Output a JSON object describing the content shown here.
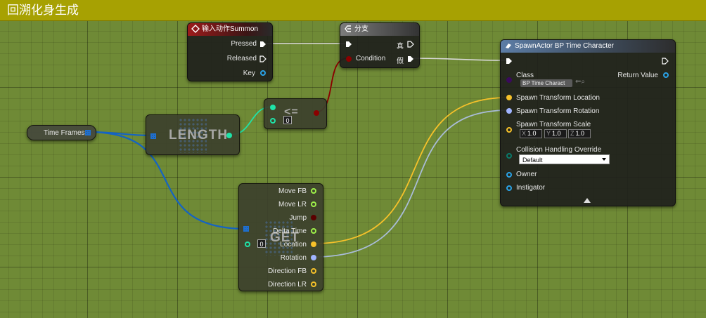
{
  "graph_title": "回溯化身生成",
  "nodes": {
    "input_action": {
      "title": "输入动作Summon",
      "pins": {
        "pressed": "Pressed",
        "released": "Released",
        "key": "Key"
      },
      "header_icon": "diamond-event-icon"
    },
    "branch": {
      "title": "分支",
      "pins": {
        "condition": "Condition",
        "true_label": "真",
        "false_label": "假"
      },
      "header_icon": "branch-icon"
    },
    "spawn_actor": {
      "title": "SpawnActor BP Time Character",
      "pins": {
        "class_label": "Class",
        "class_value": "BP Time Charact",
        "return_value": "Return Value",
        "spawn_location": "Spawn Transform Location",
        "spawn_rotation": "Spawn Transform Rotation",
        "spawn_scale": "Spawn Transform Scale",
        "scale_x_axis": "X",
        "scale_x": "1.0",
        "scale_y_axis": "Y",
        "scale_y": "1.0",
        "scale_z_axis": "Z",
        "scale_z": "1.0",
        "collision_label": "Collision Handling Override",
        "collision_value": "Default",
        "owner": "Owner",
        "instigator": "Instigator"
      },
      "header_icon": "spawn-icon"
    },
    "time_frames": {
      "label": "Time Frames"
    },
    "length": {
      "label": "LENGTH"
    },
    "less_equal": {
      "operator": "<=",
      "value": "0"
    },
    "get": {
      "label": "GET",
      "index_value": "0",
      "pins": {
        "move_fb": "Move FB",
        "move_lr": "Move LR",
        "jump": "Jump",
        "delta_time": "Delta Time",
        "location": "Location",
        "rotation": "Rotation",
        "direction_fb": "Direction FB",
        "direction_lr": "Direction LR"
      }
    }
  },
  "colors": {
    "background": "#6f8a36",
    "title_bar": "#a7a102",
    "exec_wire": "#e0e0e0",
    "bool_pin": "#8b0000",
    "int_pin": "#1fe3a8",
    "array_wire": "#1463c4",
    "vector_pin": "#f6c12a",
    "rotator_pin": "#a0b4ff",
    "float_pin": "#9ef04a",
    "object_pin": "#2aa3e8",
    "class_pin": "#5b0a8a"
  }
}
